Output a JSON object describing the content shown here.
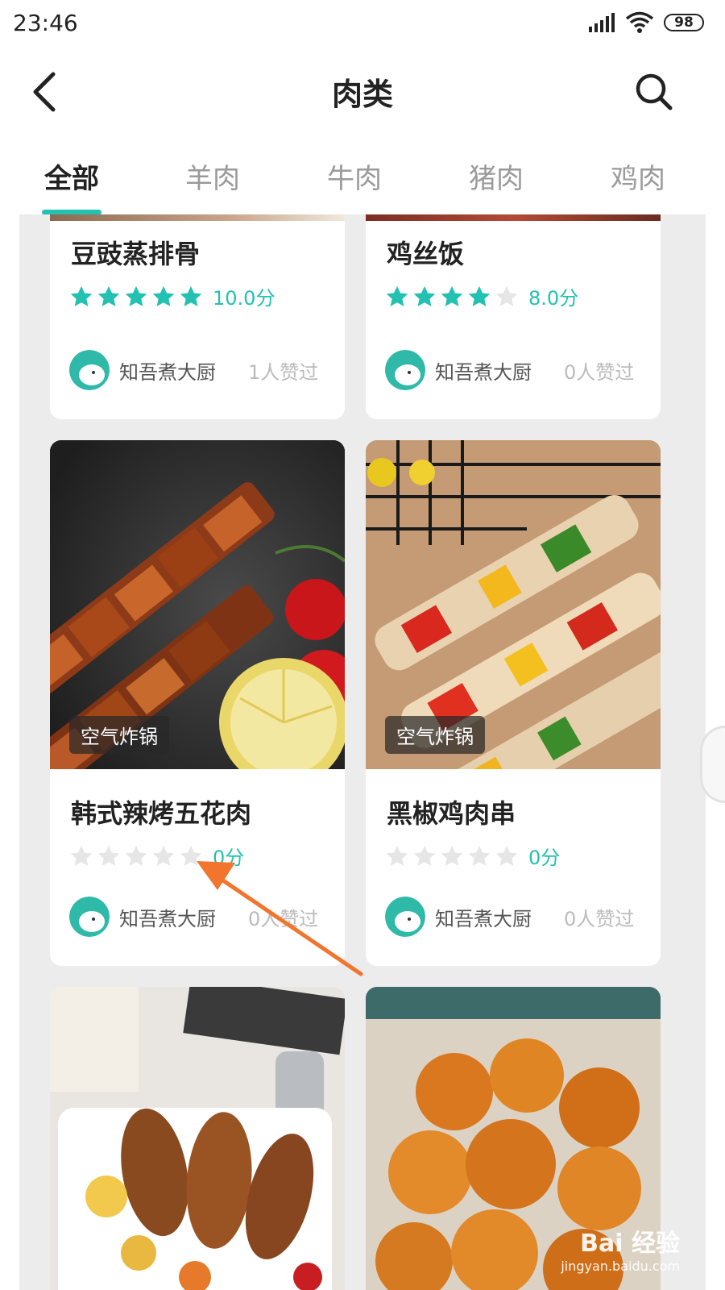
{
  "status": {
    "time": "23:46",
    "battery": "98"
  },
  "header": {
    "title": "肉类"
  },
  "tabs": [
    "全部",
    "羊肉",
    "牛肉",
    "猪肉",
    "鸡肉"
  ],
  "cards": [
    {
      "name": "豆豉蒸排骨",
      "stars": 5,
      "score": "10.0分",
      "author": "知吾煮大厨",
      "likes": "1人赞过"
    },
    {
      "name": "鸡丝饭",
      "stars": 4,
      "score": "8.0分",
      "author": "知吾煮大厨",
      "likes": "0人赞过"
    },
    {
      "name": "韩式辣烤五花肉",
      "tag": "空气炸锅",
      "stars": 0,
      "score": "0分",
      "author": "知吾煮大厨",
      "likes": "0人赞过"
    },
    {
      "name": "黑椒鸡肉串",
      "tag": "空气炸锅",
      "stars": 0,
      "score": "0分",
      "author": "知吾煮大厨",
      "likes": "0人赞过"
    }
  ],
  "watermark": {
    "brand": "Bai 经验",
    "url": "jingyan.baidu.com"
  },
  "colors": {
    "accent": "#22c1b1",
    "star_empty": "#e6e6e6",
    "annotation": "#f2752e"
  }
}
